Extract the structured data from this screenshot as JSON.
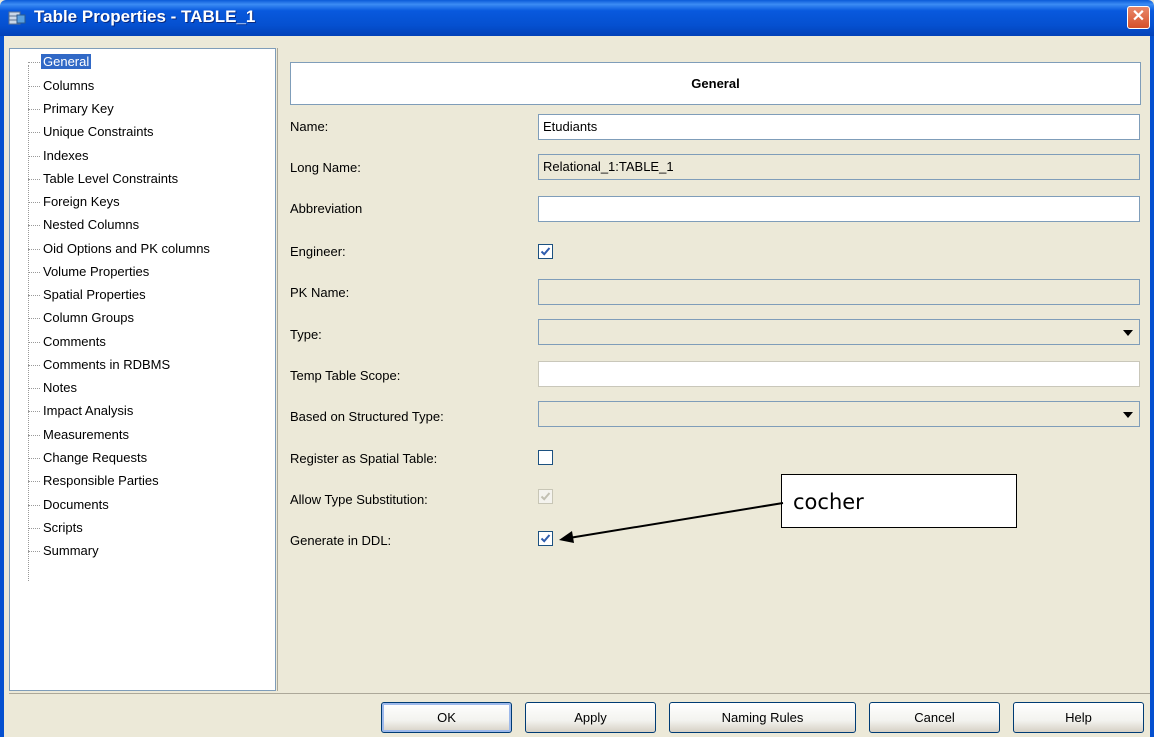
{
  "window": {
    "title": "Table Properties - TABLE_1",
    "icon": "table-icon",
    "close_icon": "close-icon"
  },
  "tree": {
    "items": [
      {
        "label": "General",
        "selected": true
      },
      {
        "label": "Columns"
      },
      {
        "label": "Primary Key"
      },
      {
        "label": "Unique Constraints"
      },
      {
        "label": "Indexes"
      },
      {
        "label": "Table Level Constraints"
      },
      {
        "label": "Foreign Keys"
      },
      {
        "label": "Nested Columns"
      },
      {
        "label": "Oid Options and PK columns"
      },
      {
        "label": "Volume Properties"
      },
      {
        "label": "Spatial Properties"
      },
      {
        "label": "Column Groups"
      },
      {
        "label": "Comments"
      },
      {
        "label": "Comments in RDBMS"
      },
      {
        "label": "Notes"
      },
      {
        "label": "Impact Analysis"
      },
      {
        "label": "Measurements"
      },
      {
        "label": "Change Requests"
      },
      {
        "label": "Responsible Parties"
      },
      {
        "label": "Documents"
      },
      {
        "label": "Scripts"
      },
      {
        "label": "Summary"
      }
    ]
  },
  "general": {
    "header": "General",
    "name_label": "Name:",
    "name_value": "Etudiants",
    "long_name_label": "Long Name:",
    "long_name_value": "Relational_1:TABLE_1",
    "abbreviation_label": "Abbreviation",
    "abbreviation_value": "",
    "engineer_label": "Engineer:",
    "engineer_checked": true,
    "pk_name_label": "PK Name:",
    "pk_name_value": "",
    "type_label": "Type:",
    "type_value": "",
    "temp_scope_label": "Temp Table Scope:",
    "temp_scope_value": "",
    "based_on_label": "Based on Structured Type:",
    "based_on_value": "",
    "register_spatial_label": "Register as Spatial Table:",
    "register_spatial_checked": false,
    "allow_subst_label": "Allow Type Substitution:",
    "allow_subst_checked": true,
    "generate_ddl_label": "Generate in DDL:",
    "generate_ddl_checked": true
  },
  "annotation": {
    "text": "cocher"
  },
  "buttons": {
    "ok": "OK",
    "apply": "Apply",
    "naming_rules": "Naming Rules",
    "cancel": "Cancel",
    "help": "Help"
  },
  "colors": {
    "titlebar": "#0550d0",
    "selection": "#3169c6",
    "check": "#2f5dad"
  }
}
